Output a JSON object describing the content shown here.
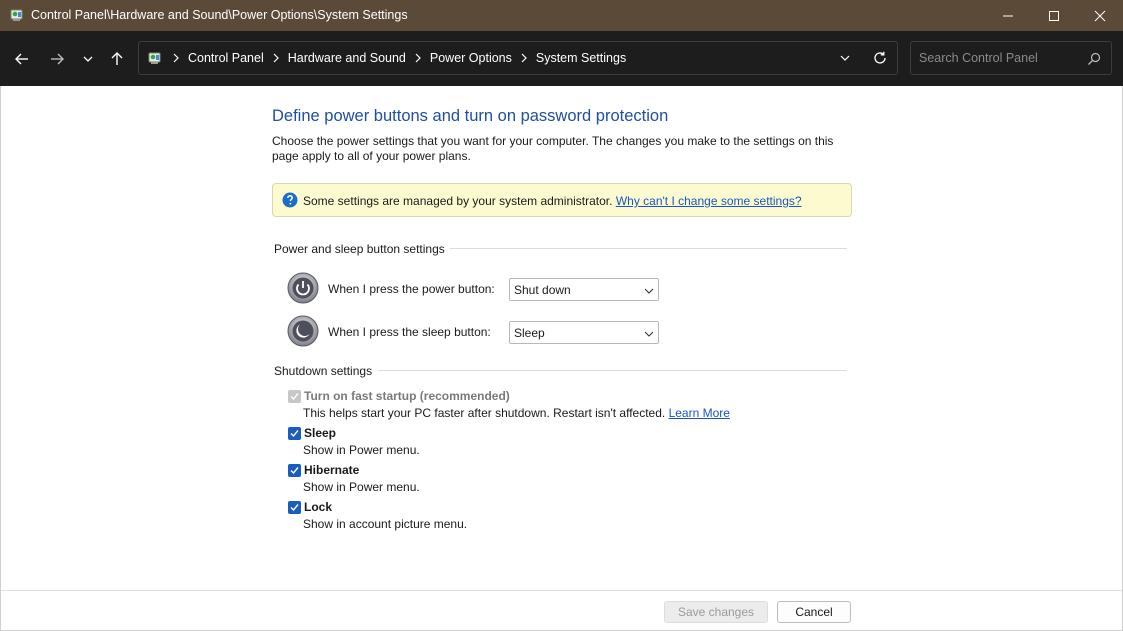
{
  "window": {
    "title": "Control Panel\\Hardware and Sound\\Power Options\\System Settings",
    "titlebar_color": "#5b4a38"
  },
  "nav": {
    "breadcrumbs": [
      "Control Panel",
      "Hardware and Sound",
      "Power Options",
      "System Settings"
    ],
    "search_placeholder": "Search Control Panel"
  },
  "page": {
    "heading": "Define power buttons and turn on password protection",
    "description": "Choose the power settings that you want for your computer. The changes you make to the settings on this page apply to all of your power plans.",
    "info_banner": {
      "text": "Some settings are managed by your system administrator.",
      "link": "Why can't I change some settings?"
    }
  },
  "power_sleep": {
    "group_label": "Power and sleep button settings",
    "power_button_label": "When I press the power button:",
    "power_button_value": "Shut down",
    "sleep_button_label": "When I press the sleep button:",
    "sleep_button_value": "Sleep"
  },
  "shutdown": {
    "group_label": "Shutdown settings",
    "items": [
      {
        "title": "Turn on fast startup (recommended)",
        "desc": "This helps start your PC faster after shutdown. Restart isn't affected.",
        "link": "Learn More",
        "checked": true,
        "disabled": true
      },
      {
        "title": "Sleep",
        "desc": "Show in Power menu.",
        "checked": true,
        "disabled": false
      },
      {
        "title": "Hibernate",
        "desc": "Show in Power menu.",
        "checked": true,
        "disabled": false
      },
      {
        "title": "Lock",
        "desc": "Show in account picture menu.",
        "checked": true,
        "disabled": false
      }
    ]
  },
  "footer": {
    "save_label": "Save changes",
    "cancel_label": "Cancel"
  },
  "colors": {
    "accent": "#1a5dbf",
    "heading": "#1f4fa0",
    "link": "#1a55c6",
    "banner_bg": "#fcfbd0"
  }
}
